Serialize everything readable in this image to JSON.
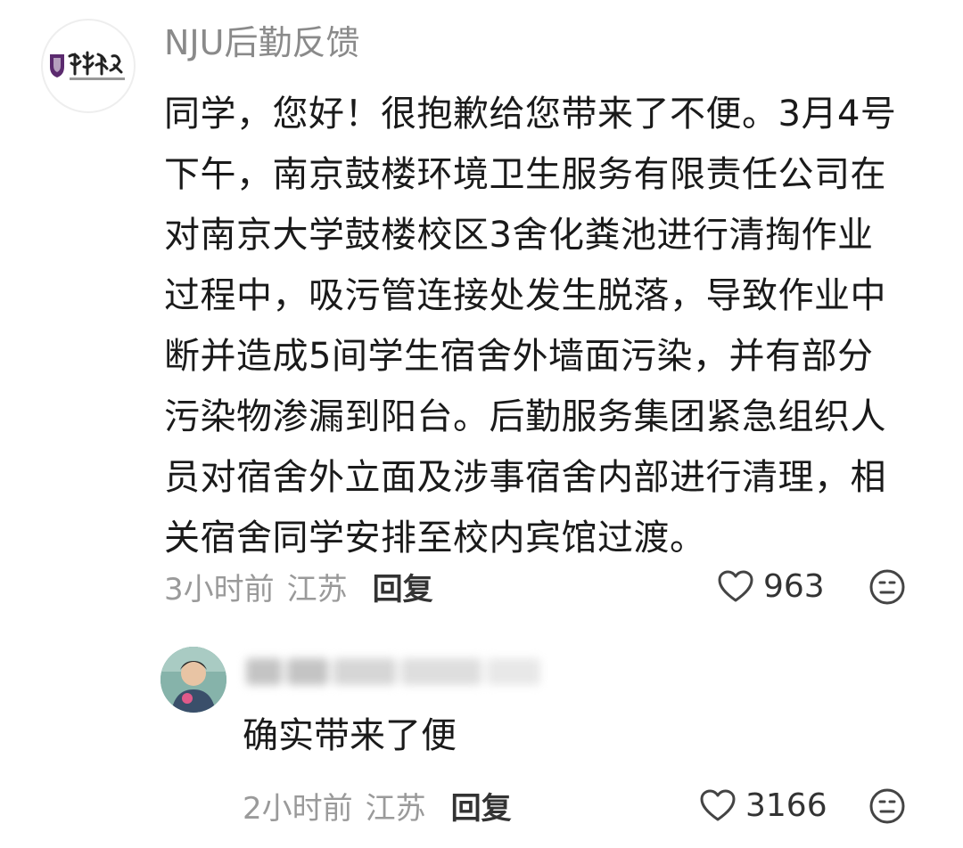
{
  "top_comment": {
    "username": "NJU后勤反馈",
    "avatar_icon": "nju-logistics-logo",
    "body_lines": [
      "同学，您好！很抱歉给您带来了不便。3月4号",
      "下午，南京鼓楼环境卫生服务有限责任公司在",
      "对南京大学鼓楼校区3舍化粪池进行清掏作业",
      "过程中，吸污管连接处发生脱落，导致作业中",
      "断并造成5间学生宿舍外墙面污染，并有部分",
      "污染物渗漏到阳台。后勤服务集团紧急组织人",
      "员对宿舍外立面及涉事宿舍内部进行清理，相",
      "关宿舍同学安排至校内宾馆过渡。"
    ],
    "time": "3小时前",
    "location": "江苏",
    "reply_label": "回复",
    "like_count": "963"
  },
  "reply_comment": {
    "username": "",
    "username_blurred": true,
    "text": "确实带来了便",
    "time": "2小时前",
    "location": "江苏",
    "reply_label": "回复",
    "like_count": "3166"
  },
  "colors": {
    "text_primary": "#1a1a1a",
    "text_secondary": "#9a9a9a",
    "username": "#8a8a8a",
    "logo_purple": "#5b2a6e"
  }
}
